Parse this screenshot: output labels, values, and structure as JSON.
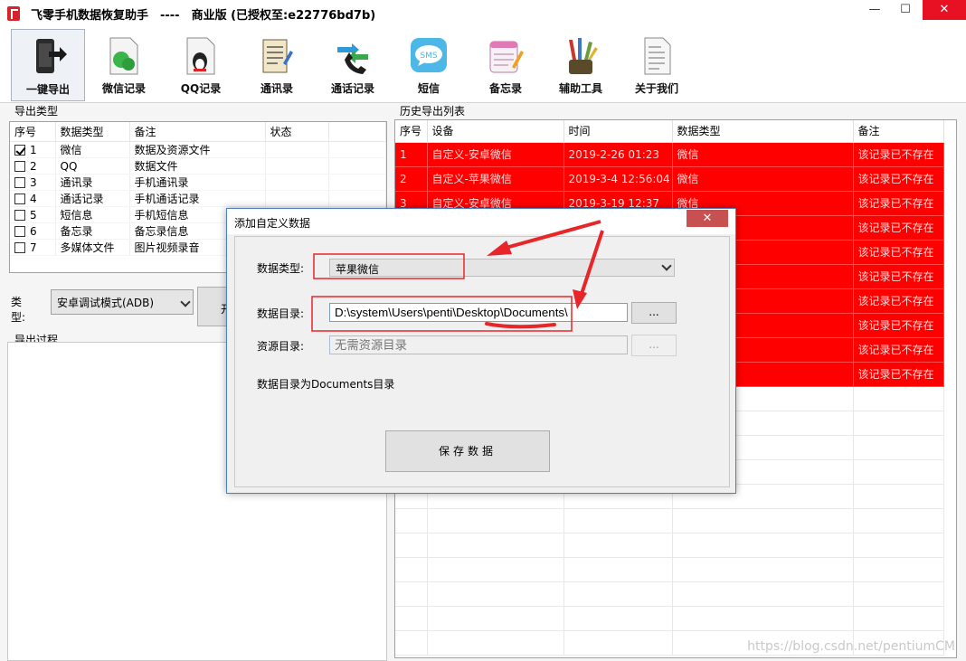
{
  "window": {
    "title": "飞零手机数据恢复助手　----　商业版 (已授权至:e22776bd7b)",
    "min_glyph": "—",
    "max_glyph": "☐",
    "close_glyph": "✕"
  },
  "toolbar": {
    "items": [
      {
        "label": "一键导出",
        "icon": "phone-export-icon"
      },
      {
        "label": "微信记录",
        "icon": "wechat-doc-icon"
      },
      {
        "label": "QQ记录",
        "icon": "qq-doc-icon"
      },
      {
        "label": "通讯录",
        "icon": "address-book-icon"
      },
      {
        "label": "通话记录",
        "icon": "call-log-icon"
      },
      {
        "label": "短信",
        "icon": "sms-icon"
      },
      {
        "label": "备忘录",
        "icon": "notes-icon"
      },
      {
        "label": "辅助工具",
        "icon": "tools-icon"
      },
      {
        "label": "关于我们",
        "icon": "about-doc-icon"
      }
    ]
  },
  "export_type": {
    "group_label": "导出类型",
    "headers": [
      "序号",
      "数据类型",
      "备注",
      "状态"
    ],
    "rows": [
      {
        "index": "1",
        "type": "微信",
        "note": "数据及资源文件",
        "status": "",
        "checked": true
      },
      {
        "index": "2",
        "type": "QQ",
        "note": "数据文件",
        "status": "",
        "checked": false
      },
      {
        "index": "3",
        "type": "通讯录",
        "note": "手机通讯录",
        "status": "",
        "checked": false
      },
      {
        "index": "4",
        "type": "通话记录",
        "note": "手机通话记录",
        "status": "",
        "checked": false
      },
      {
        "index": "5",
        "type": "短信息",
        "note": "手机短信息",
        "status": "",
        "checked": false
      },
      {
        "index": "6",
        "type": "备忘录",
        "note": "备忘录信息",
        "status": "",
        "checked": false
      },
      {
        "index": "7",
        "type": "多媒体文件",
        "note": "图片视频录音",
        "status": "",
        "checked": false
      }
    ],
    "mode_label": "类型:",
    "mode_value": "安卓调试模式(ADB)",
    "start_label": "开"
  },
  "export_log": {
    "group_label": "导出过程"
  },
  "history": {
    "group_label": "历史导出列表",
    "headers": [
      "序号",
      "设备",
      "时间",
      "数据类型",
      "备注"
    ],
    "rows": [
      {
        "index": "1",
        "device": "自定义-安卓微信",
        "time": "2019-2-26 01:23",
        "type": "微信",
        "note": "该记录已不存在"
      },
      {
        "index": "2",
        "device": "自定义-苹果微信",
        "time": "2019-3-4 12:56:04",
        "type": "微信",
        "note": "该记录已不存在"
      },
      {
        "index": "3",
        "device": "自定义-安卓微信",
        "time": "2019-3-19 12:37",
        "type": "微信",
        "note": "该记录已不存在"
      },
      {
        "index": "",
        "device": "",
        "time": "",
        "type": "",
        "note": "该记录已不存在"
      },
      {
        "index": "",
        "device": "",
        "time": "",
        "type": "",
        "note": "该记录已不存在"
      },
      {
        "index": "",
        "device": "",
        "time": "",
        "type": "",
        "note": "该记录已不存在"
      },
      {
        "index": "",
        "device": "",
        "time": "",
        "type": "",
        "note": "该记录已不存在"
      },
      {
        "index": "",
        "device": "",
        "time": "",
        "type": "",
        "note": "该记录已不存在"
      },
      {
        "index": "",
        "device": "",
        "time": "",
        "type": "",
        "note": "该记录已不存在"
      },
      {
        "index": "",
        "device": "",
        "time": "",
        "type": "",
        "note": "该记录已不存在"
      }
    ],
    "blank_rows": 11
  },
  "dialog": {
    "title": "添加自定义数据",
    "close_glyph": "✕",
    "data_type_label": "数据类型:",
    "data_type_value": "苹果微信",
    "data_dir_label": "数据目录:",
    "data_dir_value": "D:\\system\\Users\\penti\\Desktop\\Documents\\",
    "browse_label": "...",
    "res_dir_label": "资源目录:",
    "res_dir_placeholder": "无需资源目录",
    "hint": "数据目录为Documents目录",
    "save_label": "保存数据"
  },
  "annotation_color": "#e8262a",
  "watermark": "https://blog.csdn.net/pentiumCM"
}
